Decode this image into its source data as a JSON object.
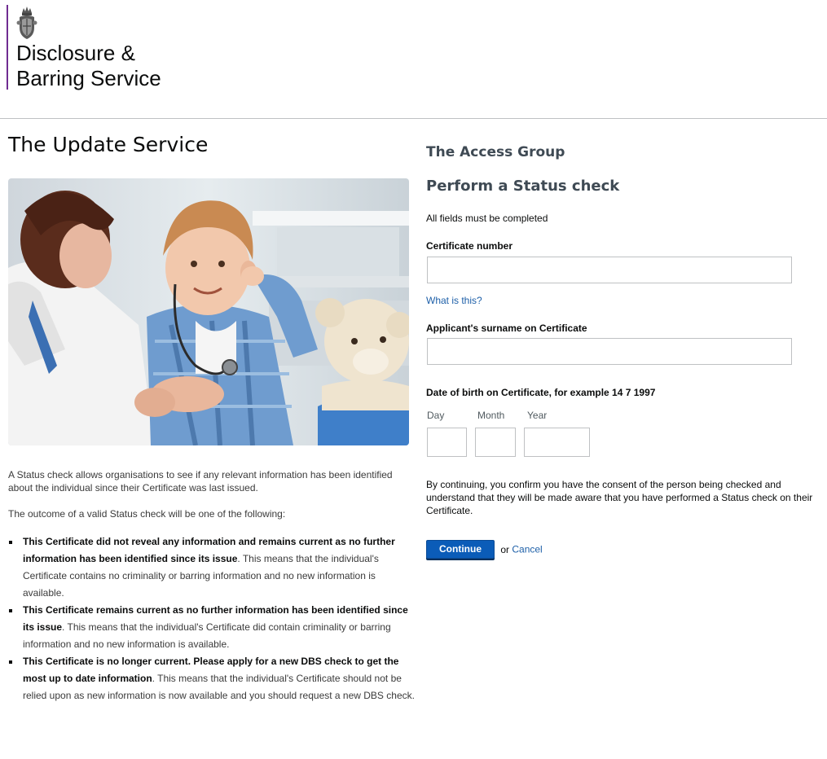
{
  "header": {
    "brand_line1": "Disclosure &",
    "brand_line2": "Barring Service",
    "crest_icon": "royal-crest-icon",
    "accent_color": "#6f2c91"
  },
  "page": {
    "title": "The Update Service"
  },
  "intro": {
    "paragraph1": "A Status check allows organisations to see if any relevant information has been identified about the individual since their Certificate was last issued.",
    "paragraph2": "The outcome of a valid Status check will be one of the following:"
  },
  "outcomes": [
    {
      "bold": "This Certificate did not reveal any information and remains current as no further information has been identified since its issue",
      "text": ". This means that the individual's Certificate contains no criminality or barring information and no new information is available."
    },
    {
      "bold": "This Certificate remains current as no further information has been identified since its issue",
      "text": ". This means that the individual's Certificate did contain criminality or barring information and no new information is available."
    },
    {
      "bold": "This Certificate is no longer current. Please apply for a new DBS check to get the most up to date information",
      "text": ". This means that the individual's Certificate should not be relied upon as new information is now available and you should request a new DBS check."
    }
  ],
  "form": {
    "organisation": "The Access Group",
    "title": "Perform a Status check",
    "note": "All fields must be completed",
    "certificate_label": "Certificate number",
    "certificate_value": "",
    "help_link": "What is this?",
    "surname_label": "Applicant's surname on Certificate",
    "surname_value": "",
    "dob_label": "Date of birth on Certificate, for example 14 7 1997",
    "day_label": "Day",
    "month_label": "Month",
    "year_label": "Year",
    "day_value": "",
    "month_value": "",
    "year_value": "",
    "consent": "By continuing, you confirm you have the consent of the person being checked and understand that they will be made aware that you have performed a Status check on their Certificate.",
    "continue_label": "Continue",
    "or_text": "or",
    "cancel_label": "Cancel",
    "button_color": "#0b5cb8",
    "link_color": "#1d5fa8"
  }
}
